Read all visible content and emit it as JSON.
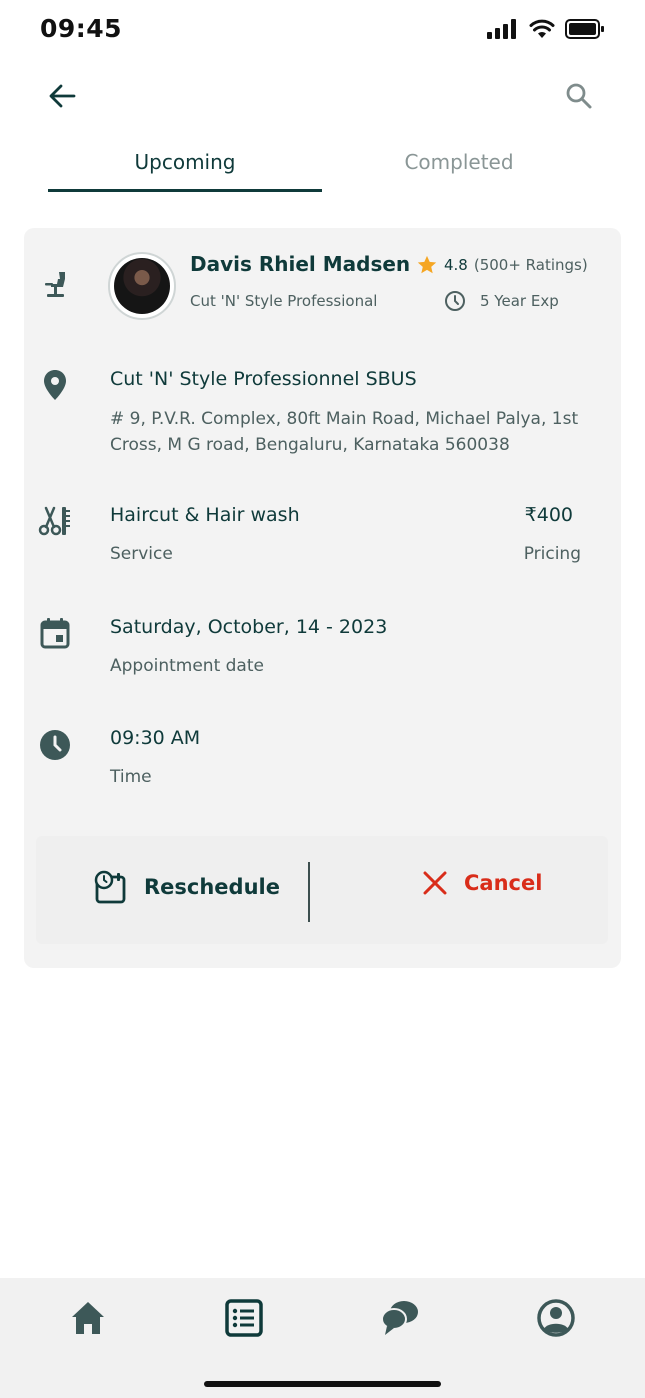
{
  "status_bar": {
    "time": "09:45"
  },
  "tabs": [
    {
      "label": "Upcoming",
      "active": true
    },
    {
      "label": "Completed",
      "active": false
    }
  ],
  "appointment": {
    "professional": {
      "name": "Davis Rhiel Madsen",
      "subtitle": "Cut 'N' Style Professional",
      "rating": "4.8",
      "ratings_count": "(500+ Ratings)",
      "experience": "5 Year Exp"
    },
    "salon": {
      "name": "Cut 'N' Style Professionnel SBUS",
      "address": "# 9, P.V.R. Complex, 80ft Main Road, Michael Palya, 1st Cross, M G road, Bengaluru, Karnataka 560038"
    },
    "service": {
      "name": "Haircut & Hair wash",
      "label": "Service",
      "price": "₹400",
      "price_label": "Pricing"
    },
    "date": {
      "value": "Saturday, October, 14 - 2023",
      "label": "Appointment date"
    },
    "time": {
      "value": "09:30 AM",
      "label": "Time"
    },
    "actions": {
      "reschedule": "Reschedule",
      "cancel": "Cancel"
    }
  },
  "icons": {
    "back": "arrow-left-icon",
    "search": "search-icon",
    "chair": "barber-chair-icon",
    "location": "location-pin-icon",
    "scissors": "scissors-comb-icon",
    "calendar": "calendar-icon",
    "clock": "clock-icon",
    "star": "star-icon",
    "reschedule": "calendar-clock-icon",
    "cancel": "close-icon",
    "nav": [
      "home-icon",
      "list-icon",
      "chat-icon",
      "profile-icon"
    ]
  },
  "colors": {
    "primary": "#0f3a3a",
    "icon": "#3d5858",
    "muted": "#4d6060",
    "star": "#f5a623",
    "cancel": "#d92d1a",
    "card": "#f3f3f3"
  }
}
